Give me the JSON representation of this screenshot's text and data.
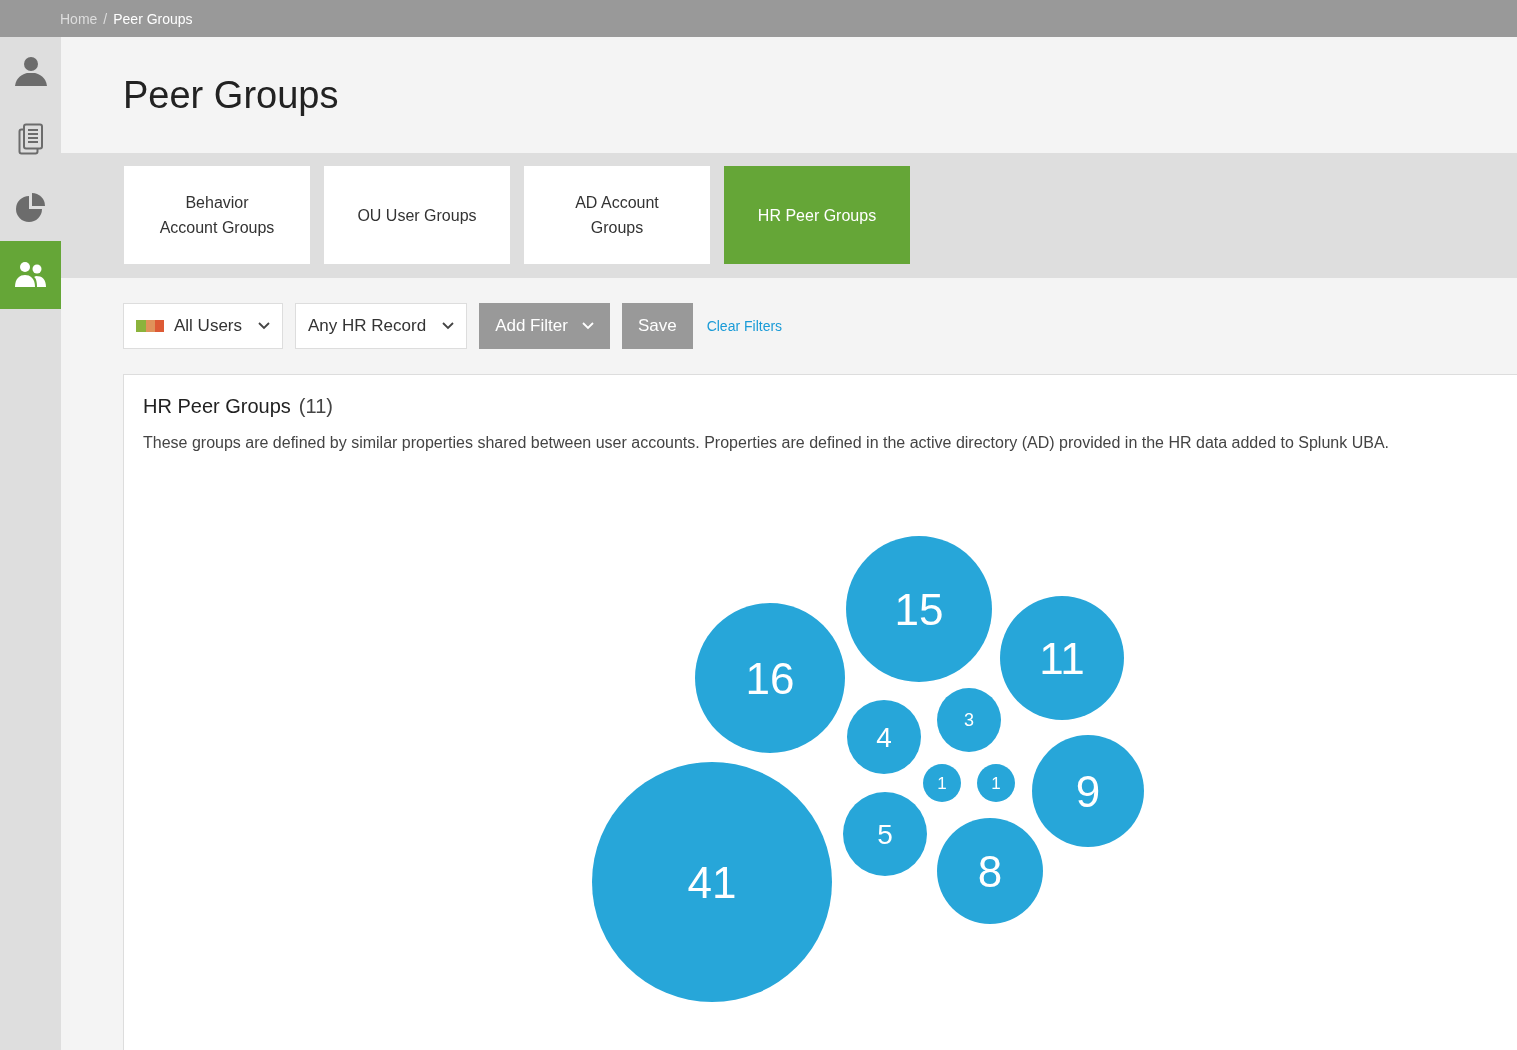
{
  "breadcrumb_separator": "/",
  "breadcrumb": [
    {
      "label": "Home",
      "current": false
    },
    {
      "label": "Peer Groups",
      "current": true
    }
  ],
  "sidebar": {
    "items": [
      {
        "kind": "user",
        "selected": false
      },
      {
        "kind": "documents",
        "selected": false
      },
      {
        "kind": "chart",
        "selected": false
      },
      {
        "kind": "group",
        "selected": true
      }
    ]
  },
  "page_title": "Peer Groups",
  "tabs": [
    {
      "label": "Behavior\nAccount Groups",
      "selected": false
    },
    {
      "label": "OU User Groups",
      "selected": false
    },
    {
      "label": "AD Account\nGroups",
      "selected": false
    },
    {
      "label": "HR Peer Groups",
      "selected": true
    }
  ],
  "filters": {
    "users": "All Users",
    "record": "Any HR Record",
    "add_filter": "Add Filter",
    "save": "Save",
    "clear": "Clear Filters"
  },
  "panel": {
    "title": "HR Peer Groups",
    "count": "(11)",
    "description": "These groups are defined by similar properties shared between user accounts. Properties are defined in the active directory (AD) provided in the HR data added to Splunk UBA.",
    "bubbles": [
      {
        "label": "15"
      },
      {
        "label": "16"
      },
      {
        "label": "11"
      },
      {
        "label": "4"
      },
      {
        "label": "3"
      },
      {
        "label": "1"
      },
      {
        "label": "1"
      },
      {
        "label": "9"
      },
      {
        "label": "5"
      },
      {
        "label": "8"
      },
      {
        "label": "41"
      }
    ]
  }
}
